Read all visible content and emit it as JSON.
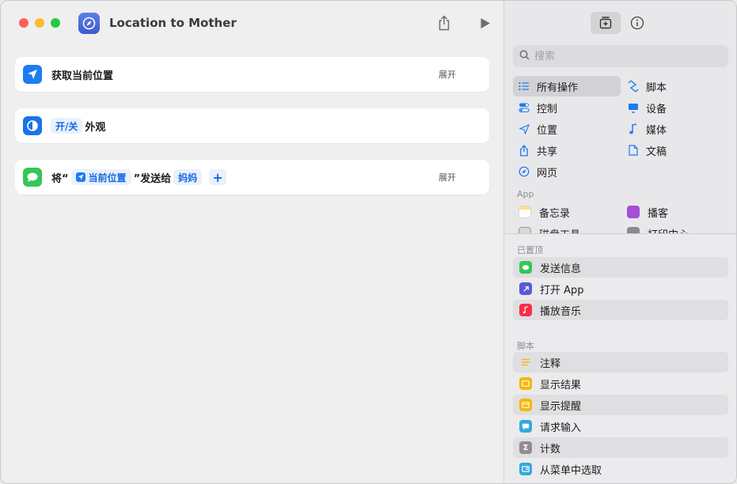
{
  "window": {
    "title": "Location to Mother"
  },
  "editor": {
    "actions": [
      {
        "label": "获取当前位置",
        "expand": "展开"
      },
      {
        "token": "开/关",
        "label": "外观"
      },
      {
        "prefix": "将“",
        "token": "当前位置",
        "middle": "”发送给",
        "recipient": "妈妈",
        "add": "+",
        "expand": "展开"
      }
    ]
  },
  "library": {
    "search_placeholder": "搜索",
    "categories": {
      "all": "所有操作",
      "scripting": "脚本",
      "controls": "控制",
      "device": "设备",
      "location": "位置",
      "media": "媒体",
      "sharing": "共享",
      "documents": "文稿",
      "web": "网页"
    },
    "apps_label": "App",
    "apps": [
      "备忘录",
      "播客",
      "磁盘工具",
      "打印中心"
    ],
    "pinned_label": "已置顶",
    "pinned": [
      "发送信息",
      "打开 App",
      "播放音乐"
    ],
    "scripting_label": "脚本",
    "scripting_items": [
      "注释",
      "显示结果",
      "显示提醒",
      "请求输入",
      "计数",
      "从菜单中选取"
    ]
  },
  "colors": {
    "accent": "#1469e0",
    "location_icon": "#1c7cf2",
    "messages_icon": "#34c759",
    "appearance_icon": "#1a73e8"
  }
}
